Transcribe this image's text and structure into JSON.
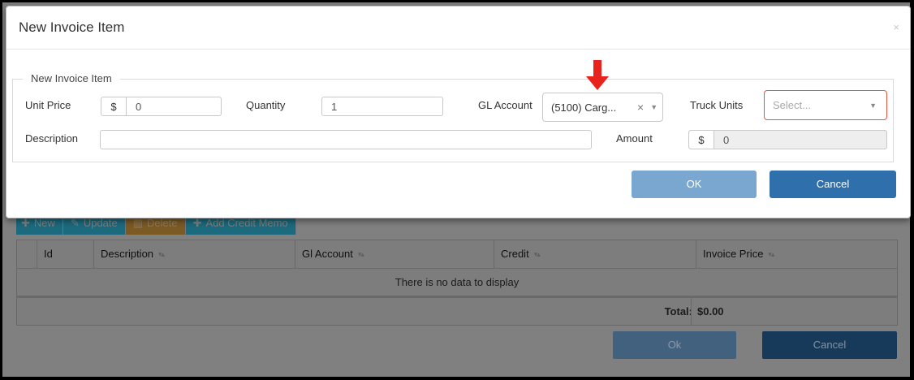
{
  "modal": {
    "title": "New Invoice Item",
    "close_glyph": "×",
    "legend": "New Invoice Item",
    "unit_price": {
      "label": "Unit Price",
      "currency": "$",
      "value": "0"
    },
    "quantity": {
      "label": "Quantity",
      "value": "1"
    },
    "gl_account": {
      "label": "GL Account",
      "selected": "(5100) Carg...",
      "clear_glyph": "×",
      "caret_glyph": "▼"
    },
    "truck_units": {
      "label": "Truck Units",
      "placeholder": "Select...",
      "caret_glyph": "▼"
    },
    "description": {
      "label": "Description",
      "value": ""
    },
    "amount": {
      "label": "Amount",
      "currency": "$",
      "value": "0"
    },
    "ok_label": "OK",
    "cancel_label": "Cancel",
    "annotation_color": "#e8231d"
  },
  "background": {
    "toolbar": [
      {
        "icon": "plus-icon",
        "glyph": "✚",
        "label": "New"
      },
      {
        "icon": "edit-icon",
        "glyph": "✎",
        "label": "Update"
      },
      {
        "icon": "trash-icon",
        "glyph": "▥",
        "label": "Delete"
      },
      {
        "icon": "plus-icon",
        "glyph": "✚",
        "label": "Add Credit Memo"
      }
    ],
    "grid": {
      "columns": [
        "Id",
        "Description",
        "Gl Account",
        "Credit",
        "Invoice Price"
      ],
      "sort_glyph": "▾▴",
      "empty_message": "There is no data to display",
      "total_label": "Total:",
      "total_value": "$0.00"
    },
    "ok_label": "Ok",
    "cancel_label": "Cancel"
  }
}
